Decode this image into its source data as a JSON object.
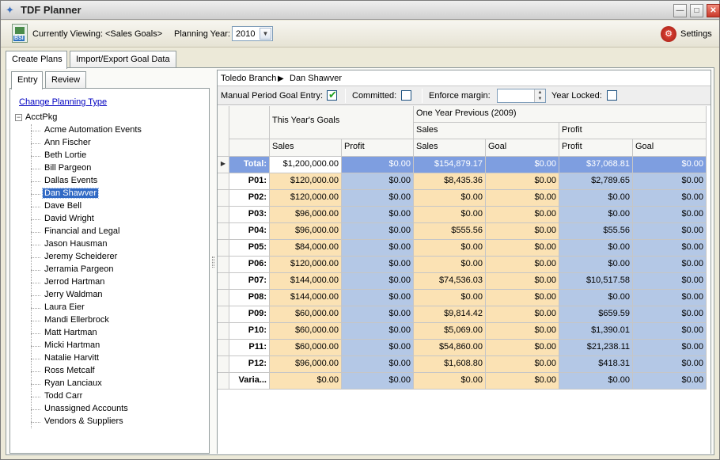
{
  "window": {
    "title": "TDF Planner"
  },
  "toolbar": {
    "viewing_label": "Currently Viewing:",
    "viewing_value": "<Sales Goals>",
    "year_label": "Planning Year:",
    "year_value": "2010",
    "settings_label": "Settings",
    "bsi_text": "BSI"
  },
  "tabs": [
    "Create Plans",
    "Import/Export Goal Data"
  ],
  "subtabs": [
    "Entry",
    "Review"
  ],
  "left": {
    "link": "Change Planning Type",
    "root": "AcctPkg",
    "selected_index": 5,
    "items": [
      "Acme Automation Events",
      "Ann Fischer",
      "Beth Lortie",
      "Bill Pargeon",
      "Dallas Events",
      "Dan Shawver",
      "Dave Bell",
      "David Wright",
      "Financial and Legal",
      "Jason Hausman",
      "Jeremy Scheiderer",
      "Jerramia Pargeon",
      "Jerrod Hartman",
      "Jerry Waldman",
      "Laura Eier",
      "Mandi Ellerbrock",
      "Matt Hartman",
      "Micki Hartman",
      "Natalie Harvitt",
      "Ross Metcalf",
      "Ryan Lanciaux",
      "Todd Carr",
      "Unassigned Accounts",
      "Vendors & Suppliers"
    ]
  },
  "breadcrumb": {
    "branch": "Toledo Branch",
    "person": "Dan Shawver"
  },
  "options": {
    "manual_label": "Manual Period Goal Entry:",
    "manual_checked": true,
    "committed_label": "Committed:",
    "committed_checked": false,
    "margin_label": "Enforce margin:",
    "margin_value": "",
    "locked_label": "Year Locked:",
    "locked_checked": false
  },
  "grid": {
    "group_this_year": "This Year's Goals",
    "group_prev": "One Year Previous (2009)",
    "sub_sales": "Sales",
    "sub_profit": "Profit",
    "columns": [
      "Sales",
      "Profit",
      "Sales",
      "Goal",
      "Profit",
      "Goal"
    ],
    "rows": [
      {
        "label": "Total:",
        "cells": [
          "$1,200,000.00",
          "$0.00",
          "$154,879.17",
          "$0.00",
          "$37,068.81",
          "$0.00"
        ]
      },
      {
        "label": "P01:",
        "cells": [
          "$120,000.00",
          "$0.00",
          "$8,435.36",
          "$0.00",
          "$2,789.65",
          "$0.00"
        ]
      },
      {
        "label": "P02:",
        "cells": [
          "$120,000.00",
          "$0.00",
          "$0.00",
          "$0.00",
          "$0.00",
          "$0.00"
        ]
      },
      {
        "label": "P03:",
        "cells": [
          "$96,000.00",
          "$0.00",
          "$0.00",
          "$0.00",
          "$0.00",
          "$0.00"
        ]
      },
      {
        "label": "P04:",
        "cells": [
          "$96,000.00",
          "$0.00",
          "$555.56",
          "$0.00",
          "$55.56",
          "$0.00"
        ]
      },
      {
        "label": "P05:",
        "cells": [
          "$84,000.00",
          "$0.00",
          "$0.00",
          "$0.00",
          "$0.00",
          "$0.00"
        ]
      },
      {
        "label": "P06:",
        "cells": [
          "$120,000.00",
          "$0.00",
          "$0.00",
          "$0.00",
          "$0.00",
          "$0.00"
        ]
      },
      {
        "label": "P07:",
        "cells": [
          "$144,000.00",
          "$0.00",
          "$74,536.03",
          "$0.00",
          "$10,517.58",
          "$0.00"
        ]
      },
      {
        "label": "P08:",
        "cells": [
          "$144,000.00",
          "$0.00",
          "$0.00",
          "$0.00",
          "$0.00",
          "$0.00"
        ]
      },
      {
        "label": "P09:",
        "cells": [
          "$60,000.00",
          "$0.00",
          "$9,814.42",
          "$0.00",
          "$659.59",
          "$0.00"
        ]
      },
      {
        "label": "P10:",
        "cells": [
          "$60,000.00",
          "$0.00",
          "$5,069.00",
          "$0.00",
          "$1,390.01",
          "$0.00"
        ]
      },
      {
        "label": "P11:",
        "cells": [
          "$60,000.00",
          "$0.00",
          "$54,860.00",
          "$0.00",
          "$21,238.11",
          "$0.00"
        ]
      },
      {
        "label": "P12:",
        "cells": [
          "$96,000.00",
          "$0.00",
          "$1,608.80",
          "$0.00",
          "$418.31",
          "$0.00"
        ]
      },
      {
        "label": "Varia...",
        "cells": [
          "$0.00",
          "$0.00",
          "$0.00",
          "$0.00",
          "$0.00",
          "$0.00"
        ]
      }
    ]
  },
  "colors": {
    "selection": "#316ac5",
    "goal_fill": "#fbe2b4",
    "prev_fill": "#b4c8e6",
    "total_fill": "#7e9ee0"
  }
}
